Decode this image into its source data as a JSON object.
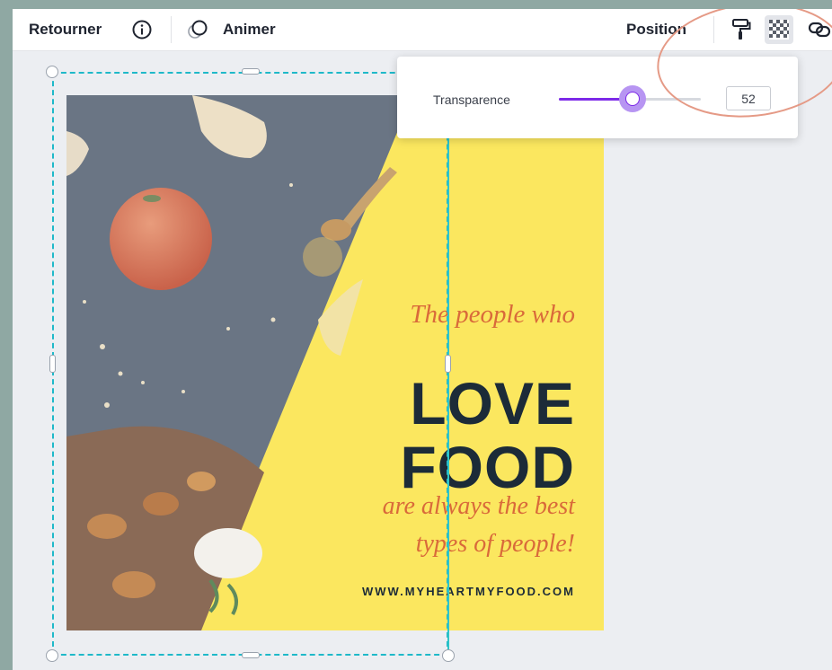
{
  "toolbar": {
    "flip_label": "Retourner",
    "animate_label": "Animer",
    "position_label": "Position"
  },
  "transparency": {
    "label": "Transparence",
    "value": "52",
    "percent": 52
  },
  "design": {
    "line1": "The people who",
    "line2": "LOVE",
    "line3": "FOOD",
    "line4": "are always the best",
    "line5": "types of people!",
    "url": "WWW.MYHEARTMYFOOD.COM"
  },
  "colors": {
    "accent": "#7d2ae8",
    "selection": "#1fb9c9",
    "design_background": "#fbe75f",
    "annotation": "#e59a86"
  },
  "icons": [
    "info-icon",
    "animate-icon",
    "paint-roller-icon",
    "transparency-icon",
    "link-icon"
  ]
}
